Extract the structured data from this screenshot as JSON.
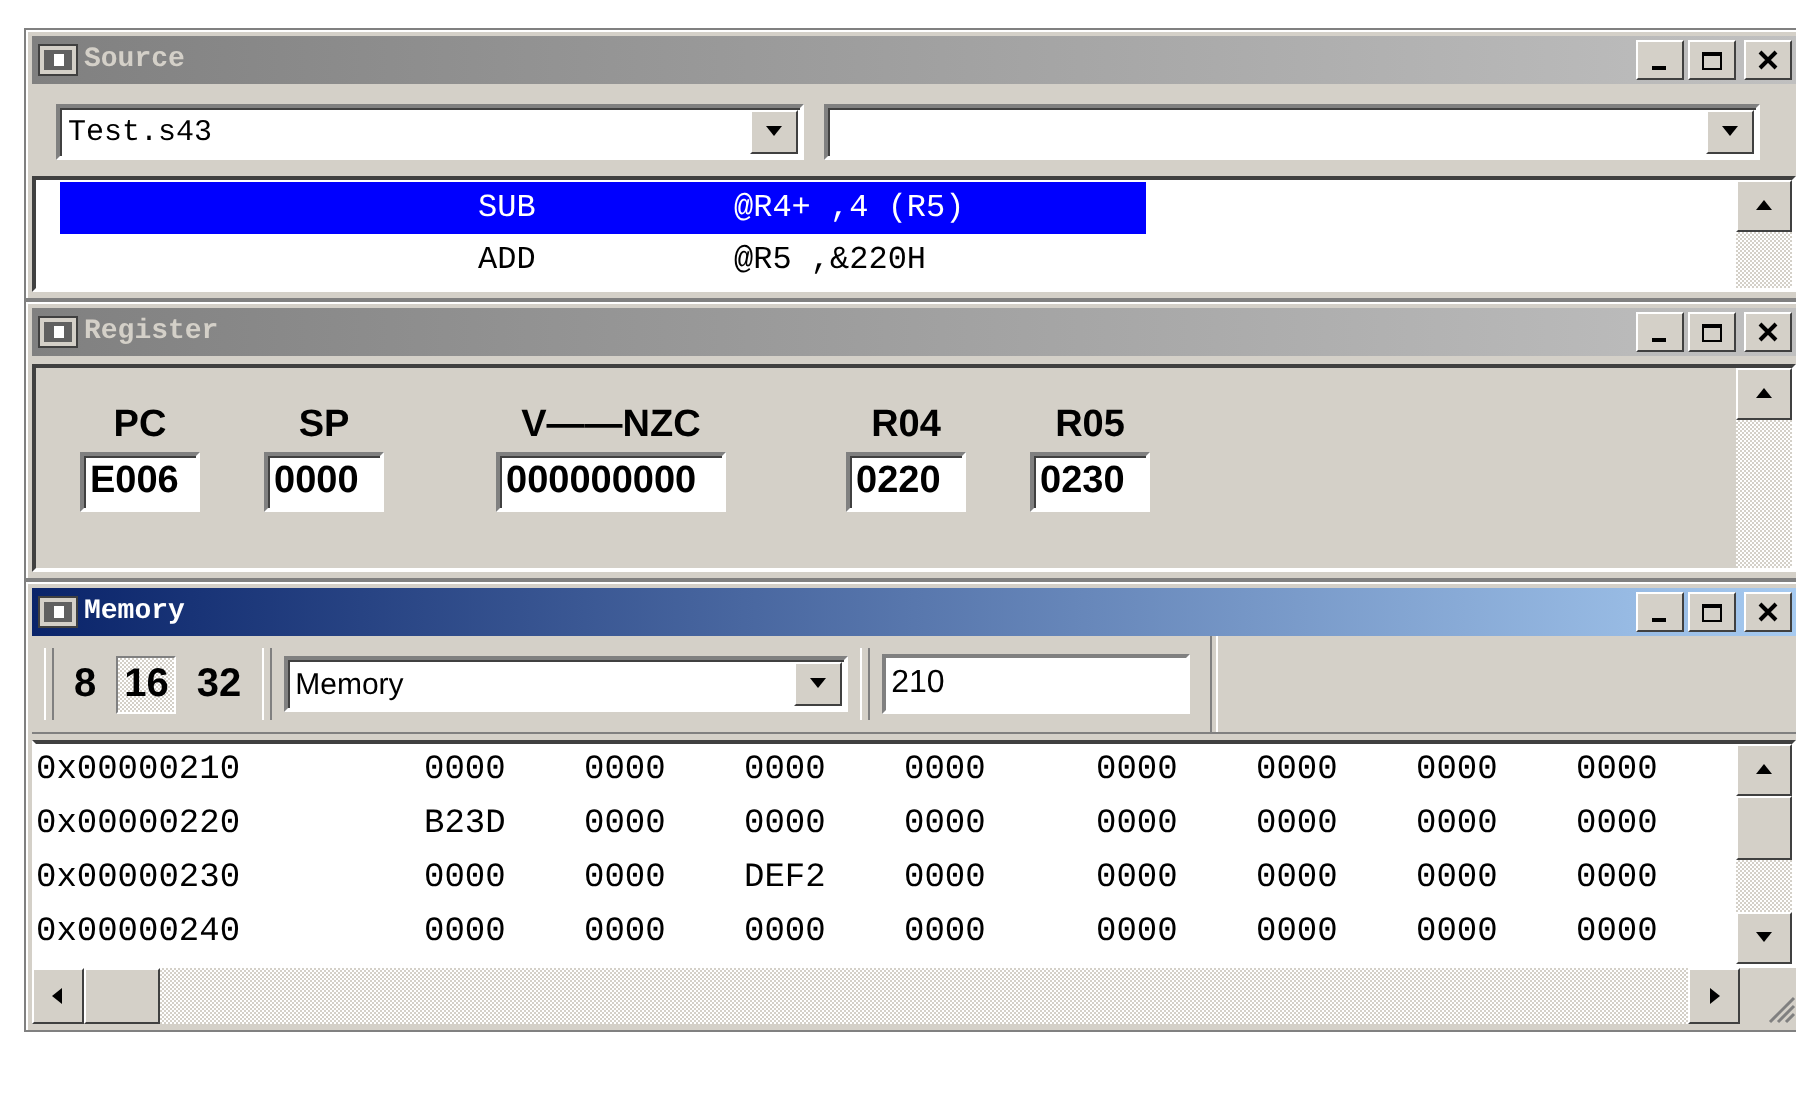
{
  "source": {
    "title": "Source",
    "active": false,
    "file_combo": "Test.s43",
    "lines": [
      {
        "mnemonic": "SUB",
        "operands": "@R4+ ,4 (R5)",
        "selected": true
      },
      {
        "mnemonic": "ADD",
        "operands": "@R5 ,&220H",
        "selected": false
      }
    ]
  },
  "register": {
    "title": "Register",
    "active": false,
    "registers": [
      {
        "label": "PC",
        "value": "E006"
      },
      {
        "label": "SP",
        "value": "0000"
      },
      {
        "label": "V——NZC",
        "value": "000000000"
      },
      {
        "label": "R04",
        "value": "0220"
      },
      {
        "label": "R05",
        "value": "0230"
      }
    ]
  },
  "memory": {
    "title": "Memory",
    "active": true,
    "width_buttons": [
      {
        "label": "8",
        "selected": false
      },
      {
        "label": "16",
        "selected": true
      },
      {
        "label": "32",
        "selected": false
      }
    ],
    "view_combo": "Memory",
    "address_field": "210",
    "rows": [
      {
        "address": "0x00000210",
        "words": [
          "0000",
          "0000",
          "0000",
          "0000",
          "0000",
          "0000",
          "0000",
          "0000"
        ]
      },
      {
        "address": "0x00000220",
        "words": [
          "B23D",
          "0000",
          "0000",
          "0000",
          "0000",
          "0000",
          "0000",
          "0000"
        ]
      },
      {
        "address": "0x00000230",
        "words": [
          "0000",
          "0000",
          "DEF2",
          "0000",
          "0000",
          "0000",
          "0000",
          "0000"
        ]
      },
      {
        "address": "0x00000240",
        "words": [
          "0000",
          "0000",
          "0000",
          "0000",
          "0000",
          "0000",
          "0000",
          "0000"
        ]
      }
    ]
  }
}
